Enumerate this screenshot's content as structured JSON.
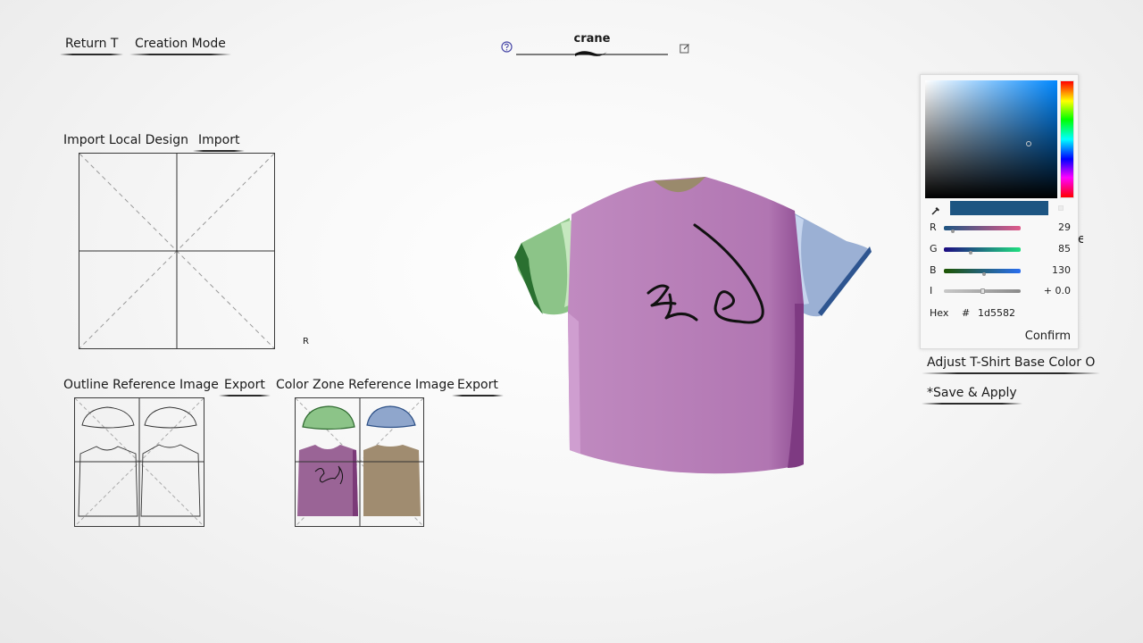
{
  "header": {
    "return_label": "Return T",
    "mode_label": "Creation Mode",
    "project_name": "crane"
  },
  "import": {
    "title": "Import Local Design",
    "button_label": "Import",
    "marker": "R"
  },
  "outline": {
    "title": "Outline Reference Image",
    "export_label": "Export"
  },
  "colorzone": {
    "title": "Color Zone Reference Image",
    "export_label": "Export"
  },
  "tshirt": {
    "body_color": "#b87cb8",
    "left_sleeve_color": "#8cc488",
    "right_sleeve_color": "#9bb0d4",
    "collar_color": "#9a8a6c"
  },
  "color_picker": {
    "swatch_color": "#1d5582",
    "r_label": "R",
    "r_value": "29",
    "g_label": "G",
    "g_value": "85",
    "b_label": "B",
    "b_value": "130",
    "i_label": "I",
    "i_value": "+ 0.0",
    "hex_label": "Hex",
    "hex_hash": "#",
    "hex_value": "1d5582",
    "confirm_label": "Confirm"
  },
  "actions": {
    "adjust_label": "Adjust T-Shirt Base Color O",
    "save_label": "*Save & Apply",
    "clipped_char": "e"
  }
}
